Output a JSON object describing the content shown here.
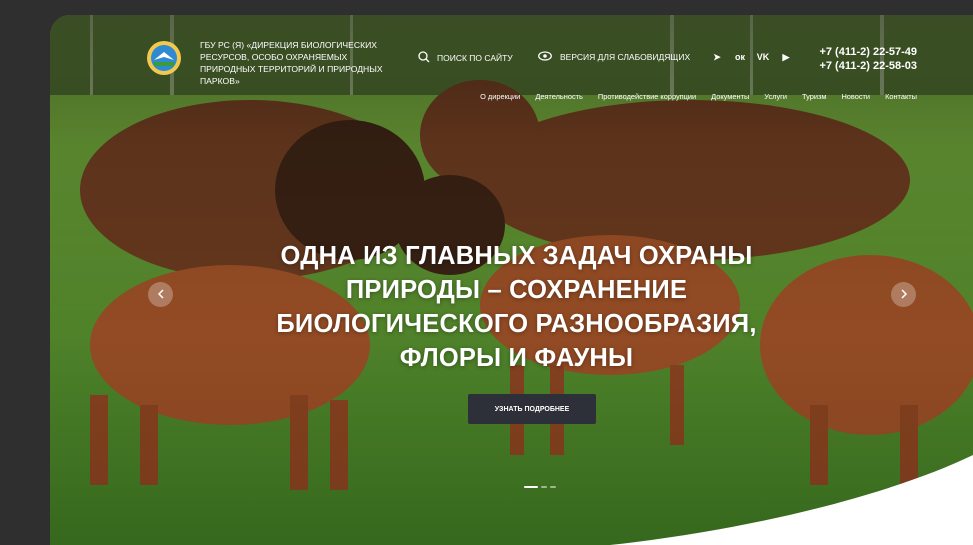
{
  "header": {
    "org_name": "ГБУ РС (Я) «Дирекция биологических ресурсов, особо охраняемых природных территорий и природных парков»",
    "search_label": "Поиск по сайту",
    "low_vision_label": "Версия для слабовидящих",
    "phones": [
      "+7 (411-2) 22-57-49",
      "+7 (411-2) 22-58-03"
    ],
    "socials": [
      {
        "name": "telegram-icon",
        "glyph": "➤"
      },
      {
        "name": "odnoklassniki-icon",
        "glyph": "ок"
      },
      {
        "name": "vk-icon",
        "glyph": "VK"
      },
      {
        "name": "youtube-icon",
        "glyph": "▶"
      }
    ]
  },
  "nav": {
    "items": [
      "О дирекции",
      "Деятельность",
      "Противодействие коррупции",
      "Документы",
      "Услуги",
      "Туризм",
      "Новости",
      "Контакты"
    ]
  },
  "hero": {
    "headline_lines": [
      "Одна из главных задач охраны",
      "природы – сохранение",
      "биологического разнообразия,",
      "флоры и фауны"
    ],
    "cta_label": "Узнать подробнее",
    "slides_count": 3,
    "active_slide": 1
  },
  "colors": {
    "page_bg": "#2f2f2f",
    "button_bg": "#2d3038",
    "text": "#ffffff"
  }
}
